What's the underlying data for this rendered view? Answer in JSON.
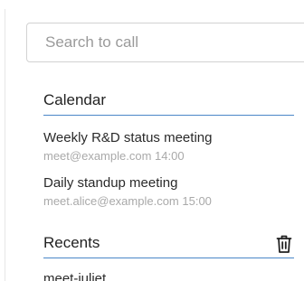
{
  "search": {
    "placeholder": "Search to call"
  },
  "calendar": {
    "title": "Calendar",
    "items": [
      {
        "title": "Weekly R&D status meeting",
        "subtitle": "meet@example.com 14:00"
      },
      {
        "title": "Daily standup meeting",
        "subtitle": "meet.alice@example.com 15:00"
      }
    ]
  },
  "recents": {
    "title": "Recents",
    "clear_icon": "trash-icon",
    "items": [
      {
        "title": "meet-juliet"
      }
    ]
  },
  "colors": {
    "accent_line": "#4a86c8",
    "secondary_text": "#a9a9a9"
  }
}
